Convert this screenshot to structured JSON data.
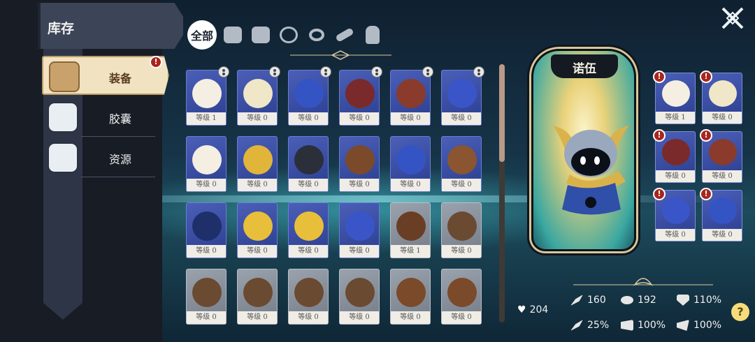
{
  "title": "库存",
  "categories": [
    {
      "label": "装备",
      "icon": "gear-bag-icon",
      "alert": "!"
    },
    {
      "label": "胶囊",
      "icon": "capsule-icon"
    },
    {
      "label": "资源",
      "icon": "resource-bag-icon"
    }
  ],
  "filters": {
    "all": "全部",
    "icons": [
      "helmet-icon",
      "armor-icon",
      "necklace-icon",
      "ring-icon",
      "belt-icon",
      "glove-icon"
    ]
  },
  "items": [
    {
      "level": "等级 1",
      "icon": "hat-icon",
      "equipped": true,
      "rarity": "blue"
    },
    {
      "level": "等级 0",
      "icon": "cape-icon",
      "equipped": true,
      "rarity": "blue"
    },
    {
      "level": "等级 0",
      "icon": "glove-icon",
      "equipped": true,
      "rarity": "blue"
    },
    {
      "level": "等级 0",
      "icon": "amulet-icon",
      "equipped": true,
      "rarity": "blue"
    },
    {
      "level": "等级 0",
      "icon": "bracelet-icon",
      "equipped": true,
      "rarity": "blue"
    },
    {
      "level": "等级 0",
      "icon": "scarf-icon",
      "equipped": true,
      "rarity": "blue"
    },
    {
      "level": "等级 0",
      "icon": "hat-icon",
      "rarity": "blue"
    },
    {
      "level": "等级 0",
      "icon": "helmet-icon",
      "rarity": "blue"
    },
    {
      "level": "等级 0",
      "icon": "dark-helmet-icon",
      "rarity": "blue"
    },
    {
      "level": "等级 0",
      "icon": "leather-armor-icon",
      "rarity": "blue"
    },
    {
      "level": "等级 0",
      "icon": "glove-icon",
      "rarity": "blue"
    },
    {
      "level": "等级 0",
      "icon": "fur-glove-icon",
      "rarity": "blue"
    },
    {
      "level": "等级 0",
      "icon": "necklace-icon",
      "rarity": "blue"
    },
    {
      "level": "等级 0",
      "icon": "ring-icon",
      "rarity": "blue"
    },
    {
      "level": "等级 0",
      "icon": "ring-icon",
      "rarity": "blue"
    },
    {
      "level": "等级 0",
      "icon": "scarf-icon",
      "rarity": "blue"
    },
    {
      "level": "等级 1",
      "icon": "belt-icon",
      "rarity": "grey"
    },
    {
      "level": "等级 0",
      "icon": "leather-cap-icon",
      "rarity": "grey"
    },
    {
      "level": "等级 0",
      "icon": "leather-cap-icon",
      "rarity": "grey"
    },
    {
      "level": "等级 0",
      "icon": "leather-cap-icon",
      "rarity": "grey"
    },
    {
      "level": "等级 0",
      "icon": "leather-cap-icon",
      "rarity": "grey"
    },
    {
      "level": "等级 0",
      "icon": "leather-cap-icon",
      "rarity": "grey"
    },
    {
      "level": "等级 0",
      "icon": "leather-armor-icon",
      "rarity": "grey"
    },
    {
      "level": "等级 0",
      "icon": "leather-armor-icon",
      "rarity": "grey"
    }
  ],
  "hero": {
    "name": "诺伍"
  },
  "slots": [
    {
      "level": "等级 1",
      "icon": "hat-icon",
      "alert": "!"
    },
    {
      "level": "等级 0",
      "icon": "cape-icon",
      "alert": "!"
    },
    {
      "level": "等级 0",
      "icon": "amulet-icon",
      "alert": "!"
    },
    {
      "level": "等级 0",
      "icon": "bracelet-icon",
      "alert": "!"
    },
    {
      "level": "等级 0",
      "icon": "scarf-icon",
      "alert": "!"
    },
    {
      "level": "等级 0",
      "icon": "glove-icon",
      "alert": "!"
    }
  ],
  "stats": {
    "hp": "204",
    "attack": "160",
    "magic": "192",
    "defense": "110%",
    "crit": "25%",
    "speed": "100%",
    "move": "100%"
  },
  "help": "?",
  "colors": {
    "rare": "#3a4ea8",
    "common": "#858d98",
    "accent": "#f1e2c2",
    "alert": "#a8261d"
  }
}
